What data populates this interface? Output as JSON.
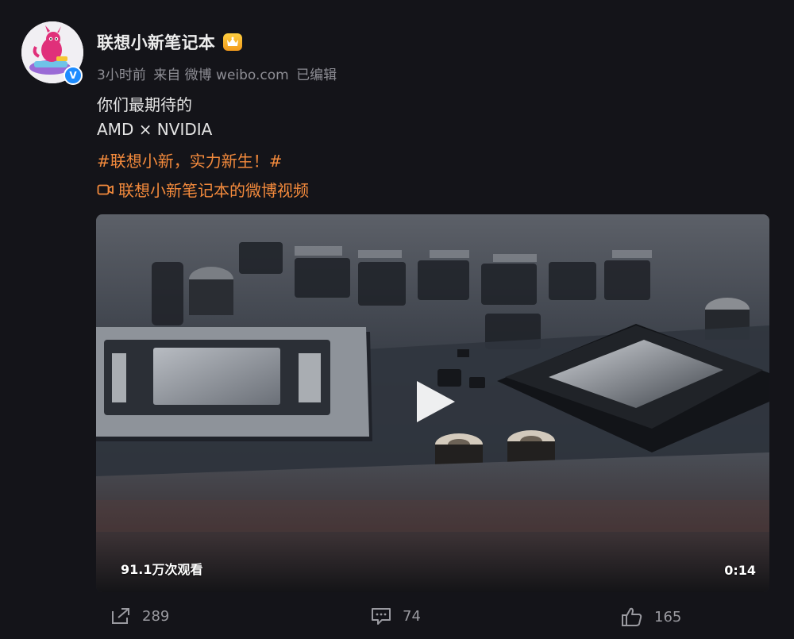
{
  "author": {
    "name": "联想小新笔记本",
    "avatar_icon": "cartoon-mascot-avatar",
    "verified_icon": "blue-verified-v-icon",
    "verified_mark": "V",
    "member_badge_icon": "gold-crown-badge-icon"
  },
  "meta": {
    "time": "3小时前",
    "source": "来自 微博 weibo.com",
    "edited": "已编辑"
  },
  "content": {
    "line1": "你们最期待的",
    "line2": "AMD × NVIDIA",
    "topic": "#联想小新，实力新生！#",
    "video_link": "联想小新笔记本的微博视频",
    "video_link_icon": "video-camera-icon"
  },
  "video": {
    "views": "91.1万次观看",
    "duration": "0:14",
    "play_icon": "play-triangle-icon"
  },
  "actions": {
    "share_count": "289",
    "comment_count": "74",
    "like_count": "165"
  },
  "colors": {
    "background": "#141419",
    "topic_orange": "#f38a3c",
    "verified_blue": "#1e8cff"
  }
}
